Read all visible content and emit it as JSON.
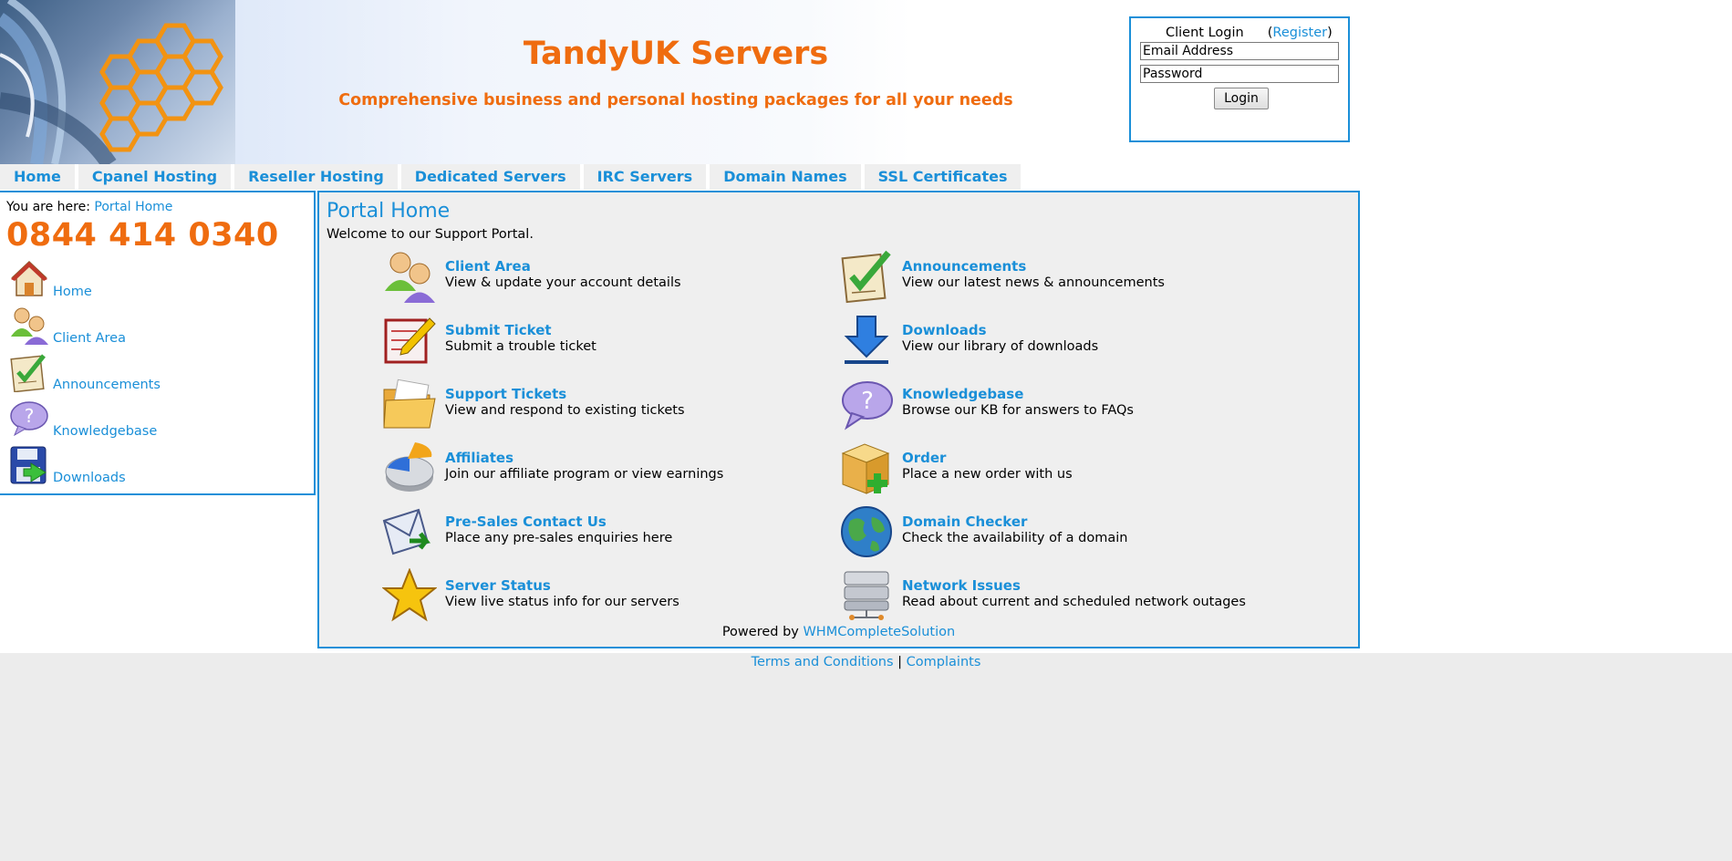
{
  "header": {
    "title": "TandyUK Servers",
    "tagline": "Comprehensive business and personal hosting packages for all your needs"
  },
  "login": {
    "heading": "Client Login",
    "register_link": "Register",
    "email_placeholder": "Email Address",
    "password_placeholder": "Password",
    "button": "Login"
  },
  "nav": {
    "tabs": [
      "Home",
      "Cpanel Hosting",
      "Reseller Hosting",
      "Dedicated Servers",
      "IRC Servers",
      "Domain Names",
      "SSL Certificates"
    ]
  },
  "sidebar": {
    "breadcrumb_prefix": "You are here:",
    "breadcrumb_link": "Portal Home",
    "phone": "0844 414 0340",
    "items": [
      {
        "label": "Home",
        "icon": "home-icon"
      },
      {
        "label": "Client Area",
        "icon": "users-icon"
      },
      {
        "label": "Announcements",
        "icon": "checklist-icon"
      },
      {
        "label": "Knowledgebase",
        "icon": "question-icon"
      },
      {
        "label": "Downloads",
        "icon": "floppy-download-icon"
      }
    ]
  },
  "main": {
    "title": "Portal Home",
    "subtitle": "Welcome to our Support Portal.",
    "features": [
      {
        "title": "Client Area",
        "desc": "View & update your account details",
        "icon": "users-icon"
      },
      {
        "title": "Announcements",
        "desc": "View our latest news & announcements",
        "icon": "checklist-icon"
      },
      {
        "title": "Submit Ticket",
        "desc": "Submit a trouble ticket",
        "icon": "ticket-pen-icon"
      },
      {
        "title": "Downloads",
        "desc": "View our library of downloads",
        "icon": "download-arrow-icon"
      },
      {
        "title": "Support Tickets",
        "desc": "View and respond to existing tickets",
        "icon": "folder-icon"
      },
      {
        "title": "Knowledgebase",
        "desc": "Browse our KB for answers to FAQs",
        "icon": "question-icon"
      },
      {
        "title": "Affiliates",
        "desc": "Join our affiliate program or view earnings",
        "icon": "pie-chart-icon"
      },
      {
        "title": "Order",
        "desc": "Place a new order with us",
        "icon": "box-add-icon"
      },
      {
        "title": "Pre-Sales Contact Us",
        "desc": "Place any pre-sales enquiries here",
        "icon": "envelope-icon"
      },
      {
        "title": "Domain Checker",
        "desc": "Check the availability of a domain",
        "icon": "globe-icon"
      },
      {
        "title": "Server Status",
        "desc": "View live status info for our servers",
        "icon": "star-icon"
      },
      {
        "title": "Network Issues",
        "desc": "Read about current and scheduled network outages",
        "icon": "server-icon"
      }
    ],
    "powered_by_prefix": "Powered by",
    "powered_by_link": "WHMCompleteSolution"
  },
  "footer": {
    "terms": "Terms and Conditions",
    "separator": "|",
    "complaints": "Complaints"
  },
  "colors": {
    "brand_orange": "#ef6c0f",
    "link_blue": "#1a8fd8",
    "panel_grey": "#efefef"
  }
}
